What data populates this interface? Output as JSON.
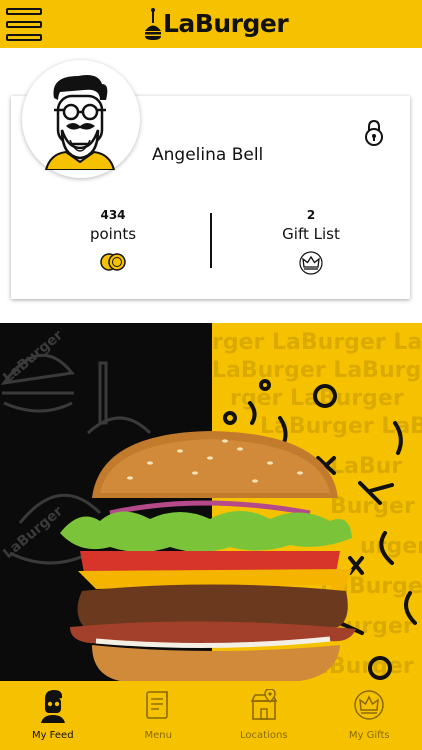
{
  "header": {
    "brand": "LaBurger",
    "menu_icon": "hamburger-menu-icon"
  },
  "profile": {
    "name": "Angelina Bell",
    "lock_icon": "lock-icon",
    "points": {
      "value": "434",
      "label": "points",
      "icon": "coins-icon"
    },
    "gifts": {
      "value": "2",
      "label": "Gift List",
      "icon": "crown-icon"
    }
  },
  "hero": {
    "watermark": "LaBurger",
    "accent_color": "#f6c200"
  },
  "nav": {
    "items": [
      {
        "label": "My Feed",
        "icon": "user-feed-icon",
        "active": true
      },
      {
        "label": "Menu",
        "icon": "menu-book-icon",
        "active": false
      },
      {
        "label": "Locations",
        "icon": "store-location-icon",
        "active": false
      },
      {
        "label": "My Gifts",
        "icon": "crown-icon",
        "active": false
      }
    ]
  },
  "colors": {
    "brand_yellow": "#f6c200",
    "text_dark": "#111111"
  }
}
